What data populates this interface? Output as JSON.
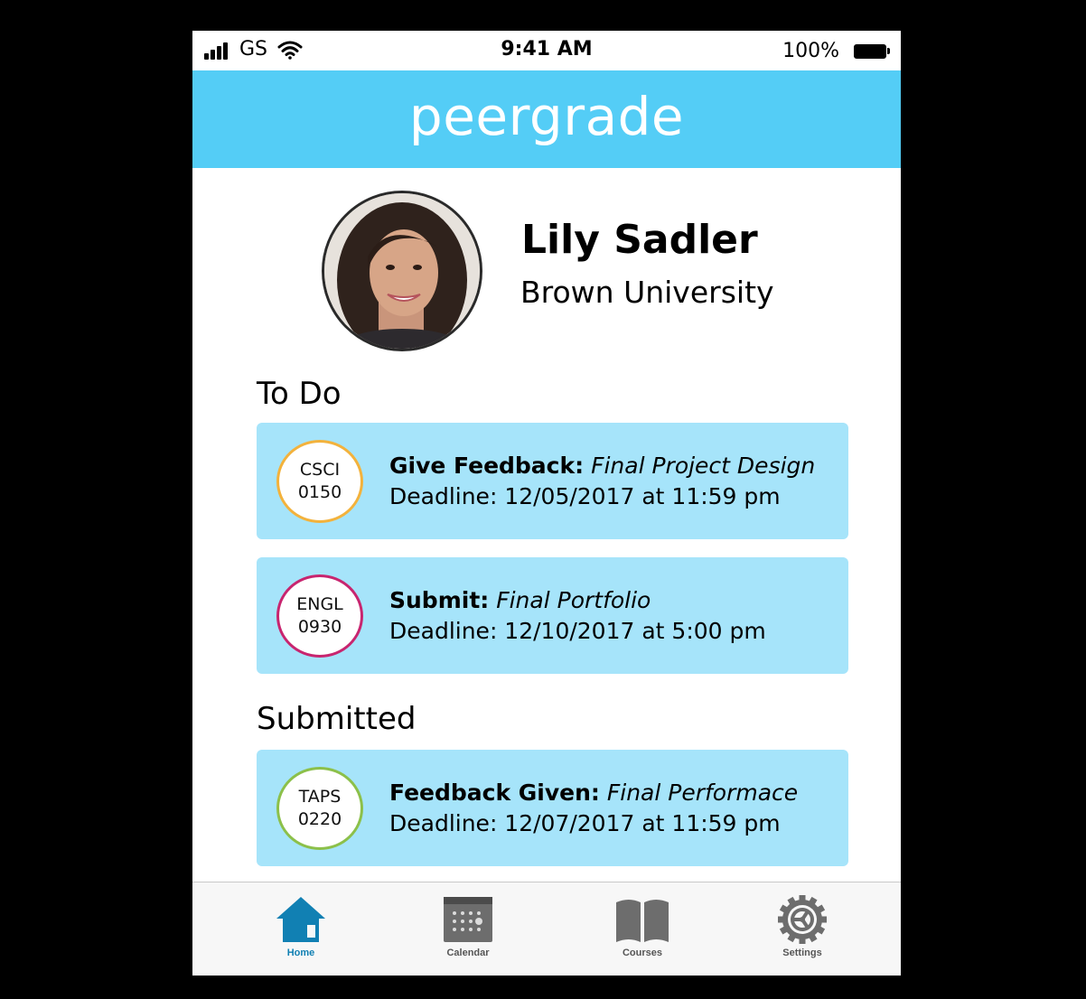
{
  "status_bar": {
    "carrier": "GS",
    "time": "9:41 AM",
    "battery_pct": "100%"
  },
  "header": {
    "brand": "peergrade"
  },
  "profile": {
    "name": "Lily Sadler",
    "school": "Brown University"
  },
  "sections": {
    "todo": "To Do",
    "submitted": "Submitted"
  },
  "cards": [
    {
      "course_line1": "CSCI",
      "course_line2": "0150",
      "action": "Give Feedback:",
      "item": "Final Project Design",
      "deadline": "Deadline: 12/05/2017 at 11:59 pm",
      "ring_color": "#f3b23c"
    },
    {
      "course_line1": "ENGL",
      "course_line2": "0930",
      "action": "Submit:",
      "item": "Final Portfolio",
      "deadline": "Deadline: 12/10/2017 at 5:00 pm",
      "ring_color": "#c8256f"
    },
    {
      "course_line1": "TAPS",
      "course_line2": "0220",
      "action": "Feedback Given:",
      "item": "Final Performace",
      "deadline": "Deadline: 12/07/2017 at 11:59 pm",
      "ring_color": "#8cc04a"
    }
  ],
  "tabs": [
    {
      "label": "Home",
      "icon": "home-icon",
      "active": true
    },
    {
      "label": "Calendar",
      "icon": "calendar-icon"
    },
    {
      "label": "Courses",
      "icon": "book-icon"
    },
    {
      "label": "Settings",
      "icon": "gear-icon"
    }
  ],
  "colors": {
    "header": "#54cdf6",
    "card": "#a6e4fa",
    "active_tab": "#1180b3",
    "inactive_tab": "#6d6d6d"
  }
}
